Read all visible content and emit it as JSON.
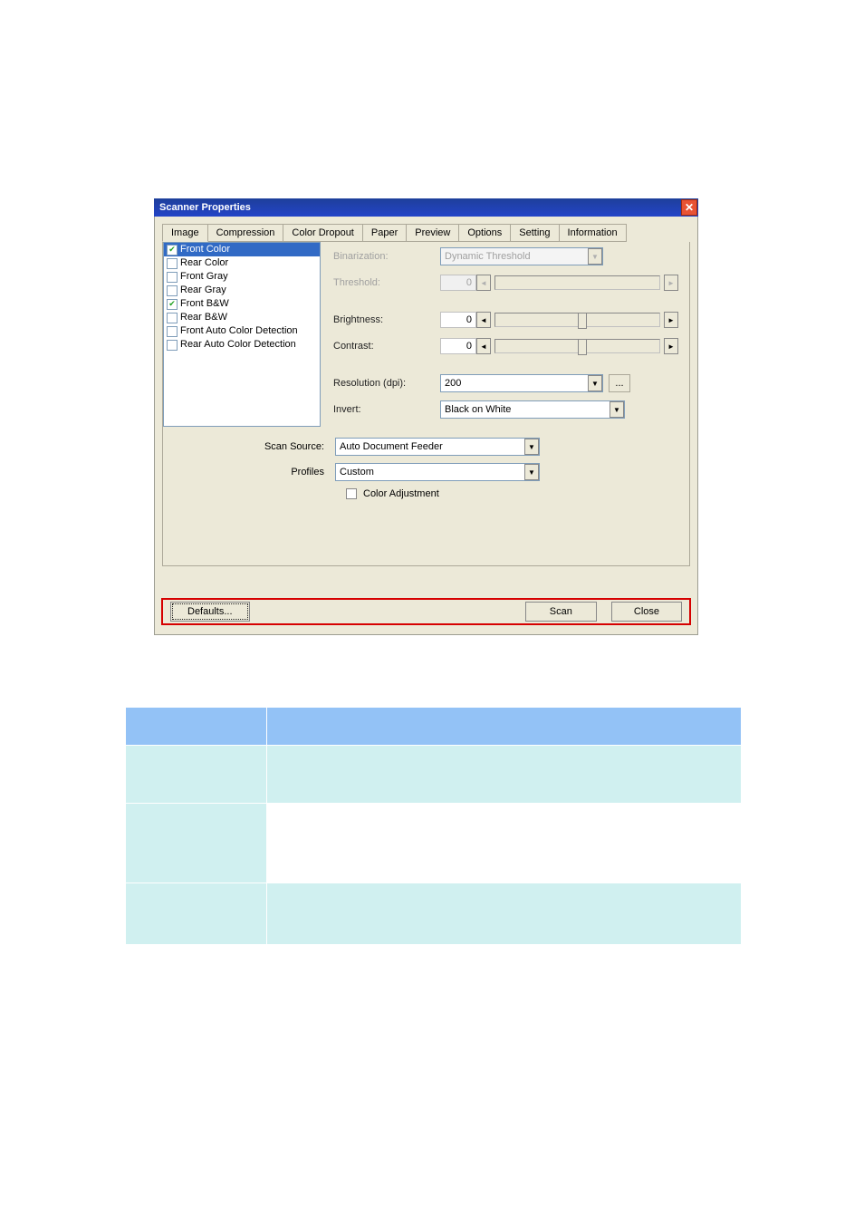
{
  "titlebar": {
    "title": "Scanner Properties",
    "close": "✕"
  },
  "tabs": [
    "Image",
    "Compression",
    "Color Dropout",
    "Paper",
    "Preview",
    "Options",
    "Setting",
    "Information"
  ],
  "image_types": [
    {
      "label": "Front Color",
      "checked": true,
      "selected": true
    },
    {
      "label": "Rear Color",
      "checked": false
    },
    {
      "label": "Front Gray",
      "checked": false
    },
    {
      "label": "Rear Gray",
      "checked": false
    },
    {
      "label": "Front B&W",
      "checked": true
    },
    {
      "label": "Rear B&W",
      "checked": false
    },
    {
      "label": "Front Auto Color Detection",
      "checked": false
    },
    {
      "label": "Rear Auto Color Detection",
      "checked": false
    }
  ],
  "fields": {
    "binarization": {
      "label": "Binarization:",
      "value": "Dynamic Threshold"
    },
    "threshold": {
      "label": "Threshold:",
      "value": "0"
    },
    "brightness": {
      "label": "Brightness:",
      "value": "0"
    },
    "contrast": {
      "label": "Contrast:",
      "value": "0"
    },
    "resolution": {
      "label": "Resolution (dpi):",
      "value": "200"
    },
    "more": "...",
    "invert": {
      "label": "Invert:",
      "value": "Black on White"
    },
    "scan_source": {
      "label": "Scan Source:",
      "value": "Auto Document Feeder"
    },
    "profiles": {
      "label": "Profiles",
      "value": "Custom"
    },
    "color_adjustment": "Color Adjustment"
  },
  "buttons": {
    "defaults": "Defaults...",
    "scan": "Scan",
    "close": "Close"
  },
  "arrows": {
    "left": "◄",
    "right": "►",
    "down": "▼"
  }
}
